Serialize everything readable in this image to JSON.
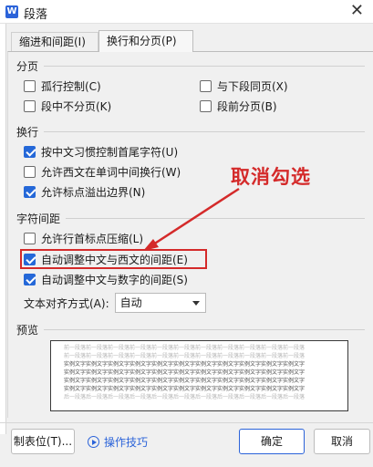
{
  "window": {
    "title": "段落",
    "app_icon_letter": "W",
    "close_glyph": "✕"
  },
  "tabs": [
    {
      "label": "缩进和间距(I)",
      "active": false
    },
    {
      "label": "换行和分页(P)",
      "active": true
    }
  ],
  "pagination": {
    "title": "分页",
    "options": [
      {
        "label": "孤行控制(C)",
        "checked": false
      },
      {
        "label": "与下段同页(X)",
        "checked": false
      },
      {
        "label": "段中不分页(K)",
        "checked": false
      },
      {
        "label": "段前分页(B)",
        "checked": false
      }
    ]
  },
  "line_break": {
    "title": "换行",
    "options": [
      {
        "label": "按中文习惯控制首尾字符(U)",
        "checked": true
      },
      {
        "label": "允许西文在单词中间换行(W)",
        "checked": false
      },
      {
        "label": "允许标点溢出边界(N)",
        "checked": true
      }
    ]
  },
  "char_spacing": {
    "title": "字符间距",
    "options": [
      {
        "label": "允许行首标点压缩(L)",
        "checked": false
      },
      {
        "label": "自动调整中文与西文的间距(E)",
        "checked": true
      },
      {
        "label": "自动调整中文与数字的间距(S)",
        "checked": true
      }
    ],
    "alignment_label": "文本对齐方式(A):",
    "alignment_value": "自动"
  },
  "annotation": {
    "text": "取消勾选",
    "color": "#d42a2a"
  },
  "preview": {
    "title": "预览",
    "grey_lines": [
      "前一段落前一段落前一段落前一段落前一段落前一段落前一段落前一段落前一段落前一段落前一段落",
      "前一段落前一段落前一段落前一段落前一段落前一段落前一段落前一段落前一段落前一段落前一段落"
    ],
    "dark_lines": [
      "实例文字实例文字实例文字实例文字实例文字实例文字实例文字实例文字实例文字实例文字实例文字",
      "实例文字实例文字实例文字实例文字实例文字实例文字实例文字实例文字实例文字实例文字实例文字",
      "实例文字实例文字实例文字实例文字实例文字实例文字实例文字实例文字实例文字实例文字实例文字",
      "实例文字实例文字实例文字实例文字实例文字实例文字实例文字实例文字实例文字实例文字实例文字"
    ],
    "after_lines": [
      "后一段落后一段落后一段落后一段落后一段落后一段落后一段落后一段落后一段落后一段落后一段落"
    ]
  },
  "footer": {
    "tabs_button": "制表位(T)...",
    "tips_link": "操作技巧",
    "ok_button": "确定",
    "cancel_button": "取消"
  },
  "colors": {
    "accent": "#2568d8",
    "annotation": "#d42a2a"
  }
}
